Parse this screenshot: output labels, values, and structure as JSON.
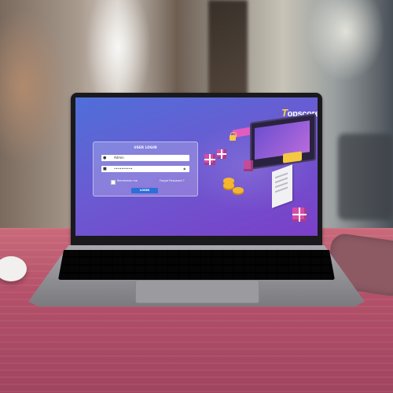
{
  "app": {
    "brand_logo": "Topscore",
    "brand_first_letter": "T",
    "brand_rest": "opscore"
  },
  "login": {
    "title": "USER LOGIN",
    "username_value": "Admin",
    "password_value": "••••••••••",
    "remember_label": "Remember me",
    "forgot_label": "Forgot Password ?",
    "login_button": "LOGIN"
  },
  "icons": {
    "user": "user-icon",
    "lock": "lock-icon",
    "show_password": "eye-icon"
  },
  "colors": {
    "screen_bg_start": "#4f6fd8",
    "screen_bg_end": "#7b3fc7",
    "login_button": "#2c6fd6",
    "brand_accent": "#ffd23f",
    "table": "#b4506a"
  }
}
